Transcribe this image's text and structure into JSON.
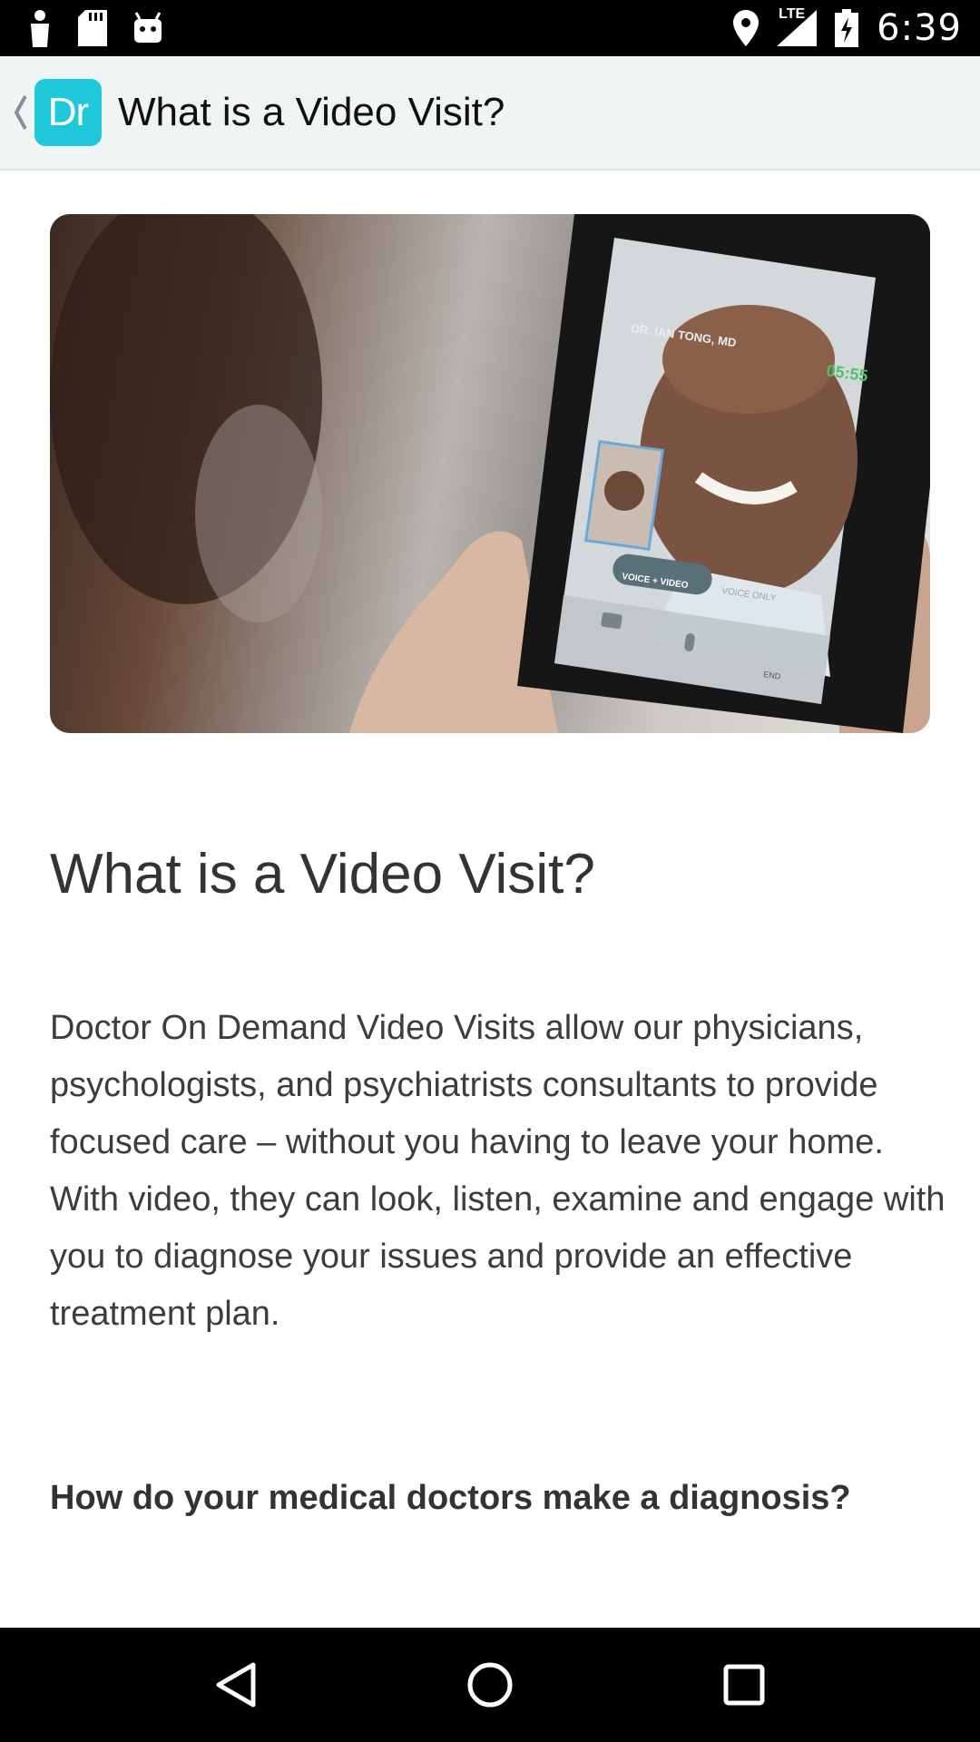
{
  "status_bar": {
    "time": "6:39",
    "network_label": "LTE",
    "icons": [
      "person-notification-icon",
      "sd-card-icon",
      "android-icon",
      "location-icon",
      "signal-icon",
      "battery-charging-icon"
    ]
  },
  "app_bar": {
    "logo_text": "Dr",
    "title": "What is a Video Visit?"
  },
  "hero": {
    "doctor_label": "DR. IAN TONG, MD",
    "timer": "05:55",
    "voice_video_label": "VOICE + VIDEO",
    "voice_only_label": "VOICE ONLY",
    "end_label": "END"
  },
  "article": {
    "heading": "What is a Video Visit?",
    "body": "Doctor On Demand Video Visits allow our physicians, psychologists, and psychiatrists consultants to provide focused care – without you having to leave your home. With video, they can look, listen, examine and engage with you to diagnose your issues and provide an effective treatment plan.",
    "subheading": "How do your medical doctors make a diagnosis?"
  },
  "colors": {
    "brand": "#20c9d9",
    "app_bar_bg": "#f1f4f5",
    "status_bar_bg": "#000000"
  },
  "nav_bar": {
    "icons": [
      "back-triangle-icon",
      "home-circle-icon",
      "recents-square-icon"
    ]
  }
}
